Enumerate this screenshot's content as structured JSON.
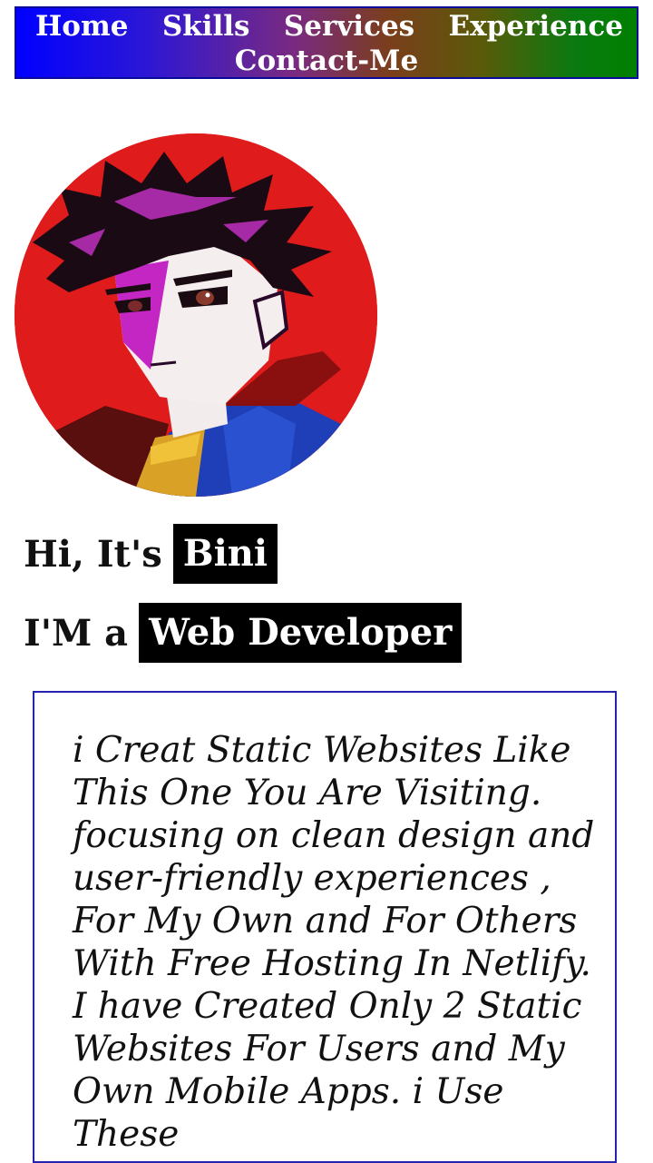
{
  "nav": {
    "items": [
      "Home",
      "Skills",
      "Services",
      "Experience",
      "Contact-Me"
    ]
  },
  "avatar": {
    "alt": "anime boy avatar"
  },
  "hero": {
    "greeting_prefix": "Hi, It's",
    "name": "Bini",
    "role_prefix": "I'M a",
    "role": "Web Developer"
  },
  "about": {
    "text": "i Creat Static Websites Like This One You Are Visiting. focusing on clean design and user-friendly experiences , For My Own and For Others With Free Hosting In Netlify. I have Created Only 2 Static Websites For Users and My Own Mobile Apps. i Use These"
  },
  "colors": {
    "nav_gradient_start": "#0000ff",
    "nav_gradient_end": "#008000",
    "avatar_background": "#e01b1b",
    "highlight_bg": "#000000",
    "box_border": "#2323b0"
  }
}
